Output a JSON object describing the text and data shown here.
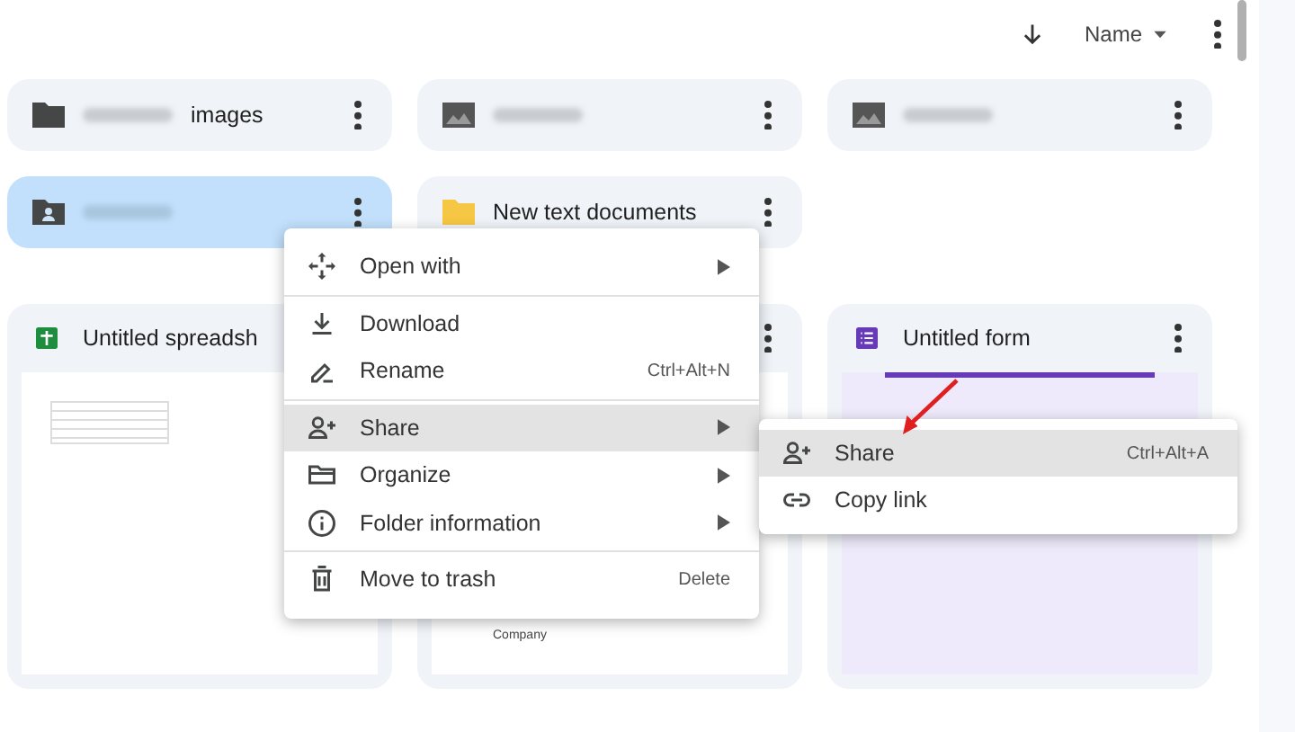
{
  "toolbar": {
    "sort_label": "Name"
  },
  "folders": [
    {
      "kind": "folder",
      "color": "#444746",
      "name": "images",
      "blurred_prefix": true,
      "selected": false
    },
    {
      "kind": "image-folder",
      "blurred_prefix": true,
      "selected": false
    },
    {
      "kind": "image-folder",
      "blurred_prefix": true,
      "selected": false
    },
    {
      "kind": "shared-folder",
      "blurred_prefix": true,
      "selected": true
    },
    {
      "kind": "folder",
      "color": "#f6c744",
      "name": "New text documents",
      "blurred_prefix": false,
      "selected": false
    }
  ],
  "files": [
    {
      "kind": "sheet",
      "name": "Untitled spreadsh"
    },
    {
      "kind": "doc",
      "thumb_text": "Company"
    },
    {
      "kind": "form",
      "name": "Untitled form"
    }
  ],
  "context_menu": {
    "groups": [
      [
        {
          "kind": "open",
          "label": "Open with",
          "submenu": true,
          "selected": false
        }
      ],
      [
        {
          "kind": "download",
          "label": "Download",
          "submenu": false,
          "selected": false
        },
        {
          "kind": "rename",
          "label": "Rename",
          "shortcut": "Ctrl+Alt+N",
          "submenu": false,
          "selected": false
        }
      ],
      [
        {
          "kind": "share",
          "label": "Share",
          "submenu": true,
          "selected": true
        },
        {
          "kind": "organize",
          "label": "Organize",
          "submenu": true,
          "selected": false
        },
        {
          "kind": "info",
          "label": "Folder information",
          "submenu": true,
          "selected": false
        }
      ],
      [
        {
          "kind": "trash",
          "label": "Move to trash",
          "shortcut": "Delete",
          "submenu": false,
          "selected": false
        }
      ]
    ]
  },
  "submenu": {
    "items": [
      {
        "kind": "share",
        "label": "Share",
        "shortcut": "Ctrl+Alt+A",
        "selected": true
      },
      {
        "kind": "link",
        "label": "Copy link",
        "selected": false
      }
    ]
  }
}
